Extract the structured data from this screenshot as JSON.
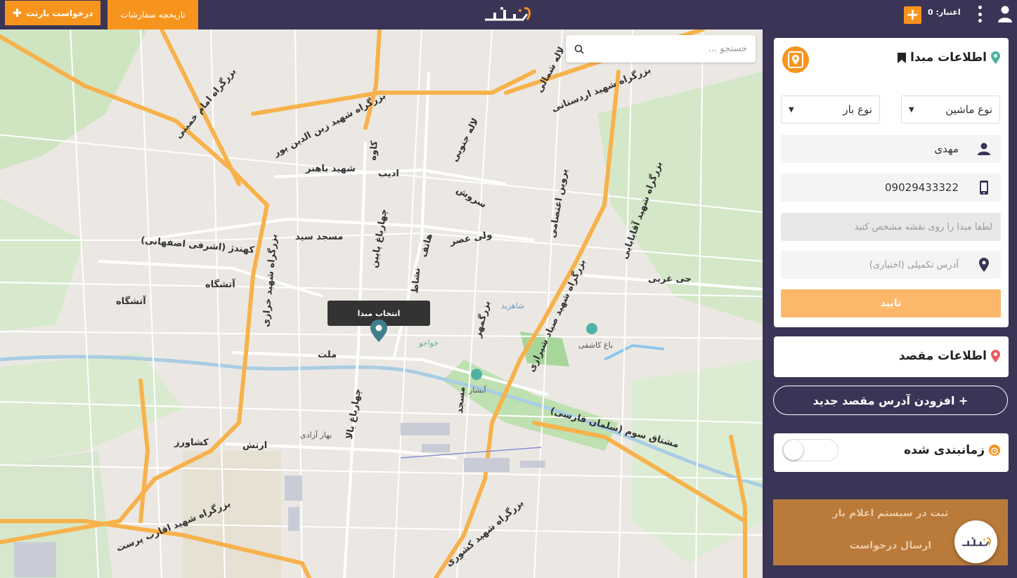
{
  "topbar": {
    "request_button": "درخواست بارنت",
    "history_button": "تاریخچه سفارشات",
    "credit_label": "اعتبار: 0",
    "brand_color": "#f7941d",
    "bar_color": "#3a3556"
  },
  "map": {
    "search_placeholder": "جستجو ...",
    "origin_tooltip": "انتخاب مبدا",
    "labels": {
      "l1": "بزرگراه شهید اردستانی",
      "l2": "بزرگراه امام خمینی",
      "l3": "بزرگراه شهید زین الدین پور",
      "l4": "شهید باهنر",
      "l5": "ادیب",
      "l6": "کاوه",
      "l7": "سروش",
      "l8": "مسجد سید",
      "l9": "کهندژ (اشرفی اصفهانی)",
      "l10": "آتشگاه",
      "l11": "آتشگاه",
      "l12": "ولی عصر",
      "l13": "جی غربی",
      "l14": "ملت",
      "l15": "ارتش",
      "l16": "کشاورز",
      "l17": "مشتاق سوم (سلمان فارسی)",
      "l18": "بزرگراه شهید اقارب پرست",
      "l19": "بزرگراه شهید صیاد شیرازی",
      "l20": "بزرگراه شهید کشوری",
      "l21": "باغ کاشفی",
      "l22": "آبشار",
      "l23": "خواجو",
      "l24": "شاهزید",
      "l25": "بهار آزادی",
      "l26": "بزرگراه شهید خرازی",
      "l27": "لاله شمالی",
      "l28": "لاله جنوبی",
      "l29": "بزرگراه شهید آقابابایی",
      "l30": "چهارباغ بالا",
      "l31": "چهارباغ پایین",
      "l32": "نشاط",
      "l33": "بزرگمهر",
      "l34": "پروین اعتصامی",
      "l35": "هاتف",
      "l36": "مسجد"
    }
  },
  "origin": {
    "title": "اطلاعات مبدا",
    "vehicle_select": "نوع ماشین",
    "load_select": "نوع بار",
    "name_value": "مهدی",
    "phone_value": "09029433322",
    "origin_placeholder": "لطفا مبدا را روی نقشه مشخص کنید",
    "extra_address_placeholder": "آدرس تکمیلی (اختیاری)",
    "confirm_button": "تایید"
  },
  "destination": {
    "title": "اطلاعات مقصد",
    "add_button": "+ افزودن آدرس مقصد جدید"
  },
  "schedule": {
    "title": "زمانبندی شده",
    "enabled": false
  },
  "bottom": {
    "register_text": "ثبت در سیستم اعلام بار",
    "send_text": "ارسال درخواست"
  },
  "icons": {
    "plus": "plus-icon",
    "user": "user-icon",
    "kebab": "kebab-menu-icon",
    "search": "search-icon",
    "pin": "map-pin-icon",
    "bookmark": "bookmark-icon",
    "person": "person-icon",
    "phone": "phone-icon",
    "alarm": "alarm-icon"
  }
}
